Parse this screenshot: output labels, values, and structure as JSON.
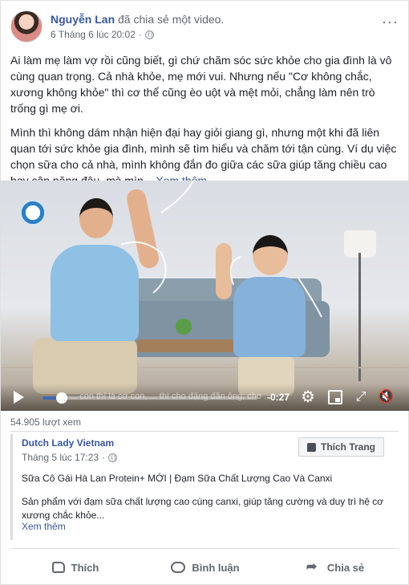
{
  "post": {
    "author": "Nguyễn Lan",
    "action": "đã chia sẻ một video.",
    "timestamp": "6 Tháng 6 lúc 20:02",
    "more_icon": "more-options-icon",
    "paragraph1": "Ai làm mẹ làm vợ rồi cũng biết, gì chứ chăm sóc sức khỏe cho gia đình là vô cùng quan trọng. Cả nhà khỏe, mẹ mới vui. Nhưng nếu \"Cơ không chắc, xương không khỏe\" thì cơ thể cũng èo uột và mệt mỏi, chẳng làm nên trò trống gì mẹ ơi.",
    "paragraph2": "Mình thì không dám nhận hiện đại hay giỏi giang gì, nhưng một khi đã liên quan tới sức khỏe gia đình, mình sẽ tìm hiểu và chăm tới tận cùng. Ví dụ việc chọn sữa cho cả nhà, mình không đắn đo giữa các sữa giúp tăng chiều cao hay cân nặng đâu, mà mìn...",
    "see_more": "Xem thêm"
  },
  "video": {
    "caption": "... con thì là cơ con, ... thì cho đặng đần ông, cho ...",
    "time_remaining": "-0:27",
    "progress": 0.09,
    "views": "54.905 lượt xem"
  },
  "shared": {
    "page_name": "Dutch Lady Vietnam",
    "timestamp": "Tháng 5 lúc 17:23",
    "like_page_label": "Thích Trang",
    "title": "Sữa Cô Gái Hà Lan Protein+ MỚI | Đạm Sữa Chất Lượng Cao Và Canxi",
    "description": "Sản phẩm với đạm sữa chất lượng cao cùng canxi, giúp tăng cường và duy trì hệ cơ xương chắc khỏe...",
    "see_more": "Xem thêm"
  },
  "actions": {
    "like": "Thích",
    "comment": "Bình luận",
    "share": "Chia sẻ"
  },
  "colors": {
    "link": "#385898",
    "accent": "#4267b2",
    "muted": "#606770"
  }
}
